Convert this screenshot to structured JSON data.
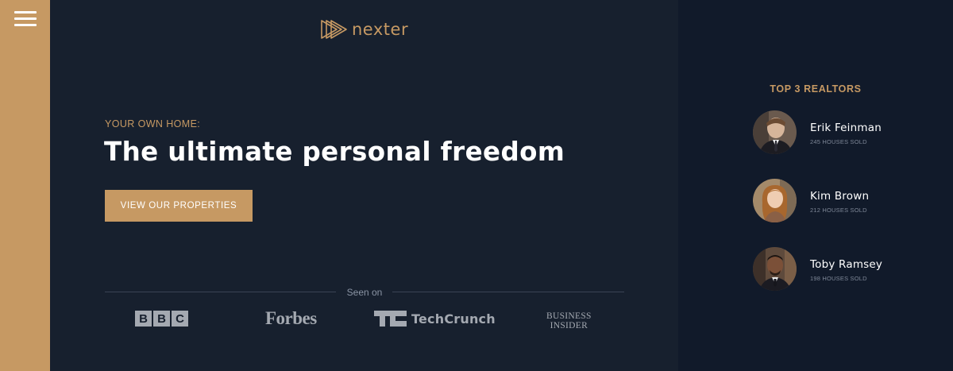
{
  "nav": {
    "menu_icon": "hamburger-menu-icon"
  },
  "brand": {
    "logo_icon": "triple-play-arrow-logo-icon",
    "name": "nexter"
  },
  "hero": {
    "eyebrow": "YOUR OWN HOME:",
    "headline": "The ultimate personal freedom",
    "cta_label": "VIEW OUR PROPERTIES"
  },
  "press": {
    "seen_on_label": "Seen on",
    "bbc": [
      "B",
      "B",
      "C"
    ],
    "forbes": "Forbes",
    "techcrunch": "TechCrunch",
    "business_insider": [
      "BUSINESS",
      "INSIDER"
    ]
  },
  "realtors": {
    "title": "TOP 3 REALTORS",
    "items": [
      {
        "name": "Erik Feinman",
        "sold": "245 HOUSES SOLD"
      },
      {
        "name": "Kim Brown",
        "sold": "212 HOUSES SOLD"
      },
      {
        "name": "Toby Ramsey",
        "sold": "198 HOUSES SOLD"
      }
    ]
  },
  "colors": {
    "accent": "#c69963",
    "hero_bg": "#17202e",
    "panel_bg": "#111a2a",
    "text_light": "#ffffff",
    "press_gray": "#a4a9b1"
  }
}
